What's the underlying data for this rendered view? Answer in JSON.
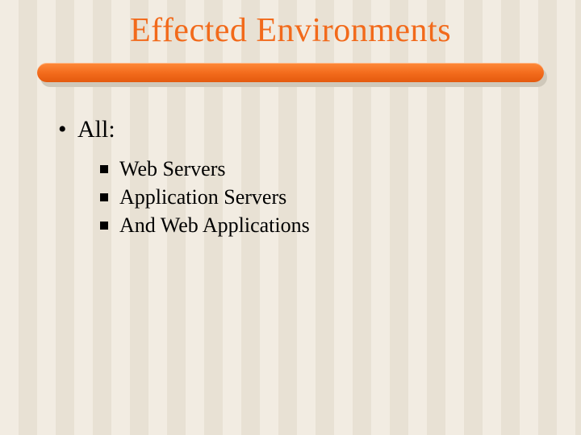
{
  "title": "Effected Environments",
  "content": {
    "heading": "All:",
    "items": [
      "Web Servers",
      "Application Servers",
      "And Web Applications"
    ]
  }
}
